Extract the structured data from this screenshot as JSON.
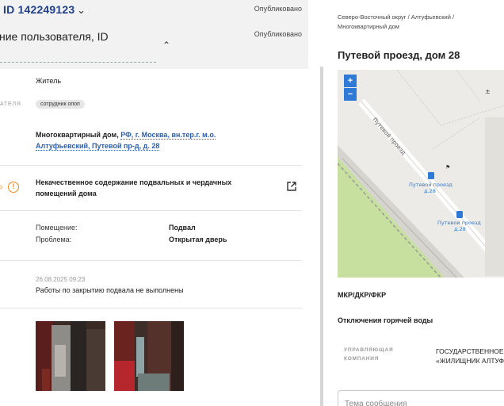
{
  "left": {
    "header": {
      "id_title": "ID 142249123",
      "status_top": "Опубликовано",
      "user_title": "ние пользователя, ID",
      "status_second": "Опубликовано"
    },
    "author_type": "Житель",
    "role_label_cut": "АТЕЛЯ",
    "role_badge": "сотрудник опоп",
    "address": {
      "object": "Многоквартирный дом, ",
      "link": "РФ, г. Москва, вн.тер.г. м.о. Алтуфьевский, Путевой пр-д, д. 28"
    },
    "problem_category_cut": "о",
    "problem_text": "Некачественное содержание подвальных и чердачных помещений дома",
    "details": [
      {
        "key": "Помещение:",
        "value": "Подвал"
      },
      {
        "key": "Проблема:",
        "value": "Открытая дверь"
      }
    ],
    "answer": {
      "date": "26.08.2025 09:23",
      "text": "Работы по закрытию подвала не выполнены"
    }
  },
  "right": {
    "breadcrumb": "Северо-Восточный округ / Алтуфьевский / Многоквартирный дом",
    "title": "Путевой проезд, дом 28",
    "map": {
      "zoom_in": "+",
      "zoom_out": "−",
      "street_label": "Путевой проезд",
      "poi1_line1": "Путевой проезд",
      "poi1_line2": "д.28",
      "poi2_line1": "Путевой проезд",
      "poi2_line2": "д.28"
    },
    "type_label": "МКР/ДКР/ФКР",
    "hot_water_label": "Отключения горячей воды",
    "management_company_label_1": "УПРАВЛЯЮЩАЯ",
    "management_company_label_2": "КОМПАНИЯ",
    "management_company_value_1": "ГОСУДАРСТВЕННОЕ",
    "management_company_value_2": "«ЖИЛИЩНИК АЛТУФ",
    "message_placeholder": "Тема сообщения"
  },
  "colors": {
    "accent_blue": "#2f7ad6",
    "link_blue": "#2a5db0",
    "warning_orange": "#f08a1a",
    "header_bg": "#f2f2f2"
  },
  "icons": [
    "chevron-down-icon",
    "chevron-up-icon",
    "warning-icon",
    "external-link-icon",
    "bus-stop-icon"
  ]
}
